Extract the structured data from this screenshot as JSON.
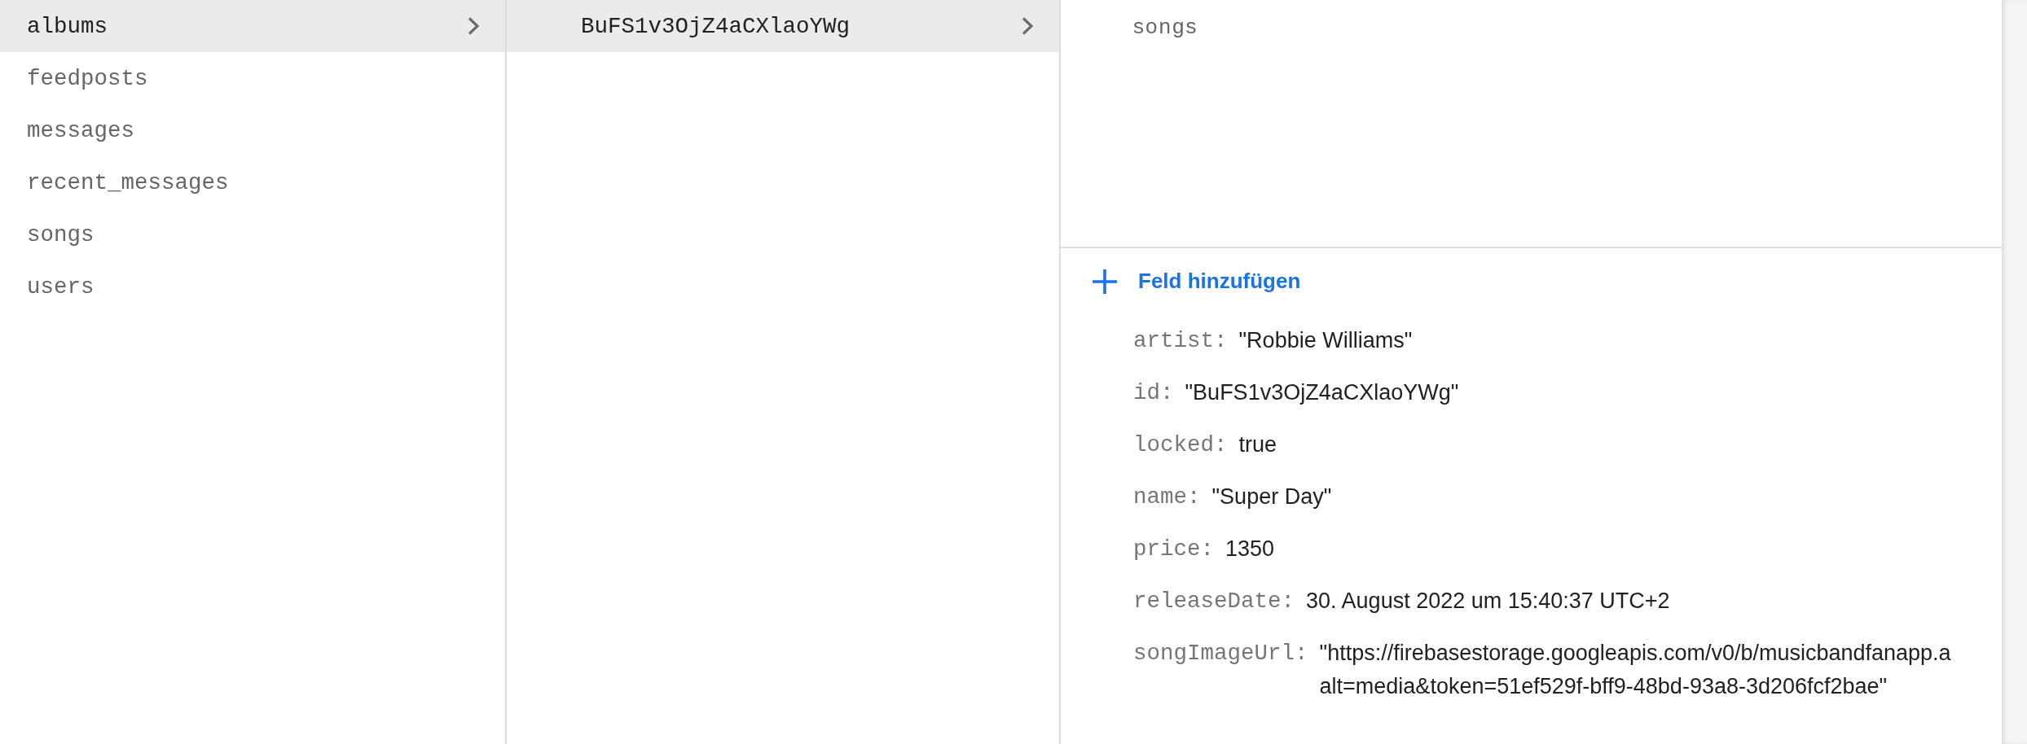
{
  "collections": [
    {
      "label": "albums",
      "selected": true
    },
    {
      "label": "feedposts",
      "selected": false
    },
    {
      "label": "messages",
      "selected": false
    },
    {
      "label": "recent_messages",
      "selected": false
    },
    {
      "label": "songs",
      "selected": false
    },
    {
      "label": "users",
      "selected": false
    }
  ],
  "documents": [
    {
      "label": "BuFS1v3OjZ4aCXlaoYWg",
      "selected": true
    }
  ],
  "document": {
    "subcollections": [
      {
        "label": "songs"
      }
    ],
    "add_field": "Feld hinzufügen",
    "fields": [
      {
        "key": "artist:",
        "value": "\"Robbie Williams\""
      },
      {
        "key": "id:",
        "value": "\"BuFS1v3OjZ4aCXlaoYWg\""
      },
      {
        "key": "locked:",
        "value": "true"
      },
      {
        "key": "name:",
        "value": "\"Super Day\""
      },
      {
        "key": "price:",
        "value": "1350"
      },
      {
        "key": "releaseDate:",
        "value": "30. August 2022 um 15:40:37 UTC+2"
      },
      {
        "key": "songImageUrl:",
        "value": "\"https://firebasestorage.googleapis.com/v0/b/musicbandfanapp.a",
        "continuation": "alt=media&token=51ef529f-bff9-48bd-93a8-3d206fcf2bae\""
      }
    ]
  }
}
